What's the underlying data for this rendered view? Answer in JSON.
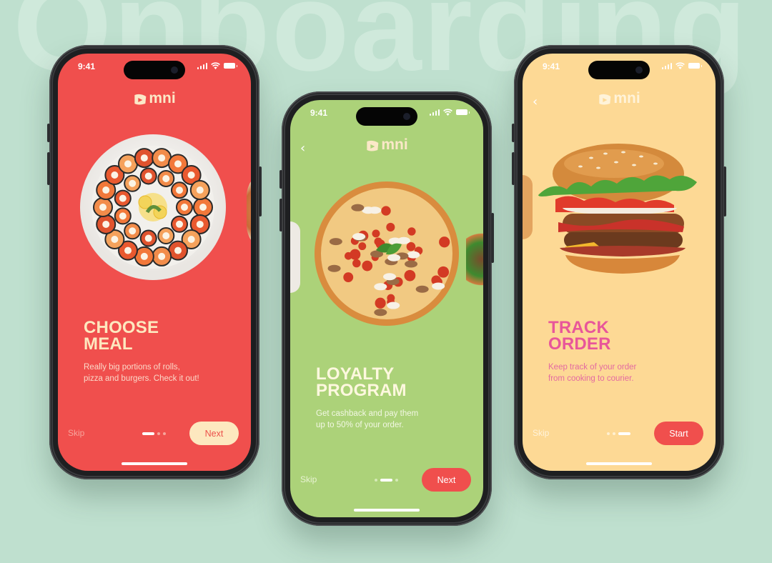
{
  "background_word": "Onboarding",
  "colors": {
    "red": "#f04f4d",
    "green": "#acd279",
    "yellow": "#fdd995",
    "pink": "#e8569a",
    "cream": "#fde8bf"
  },
  "screens": [
    {
      "id": "choose-meal",
      "time": "9:41",
      "logo": "mni",
      "title_line1": "CHOOSE",
      "title_line2": "MEAL",
      "subtitle_line1": "Really big portions of rolls,",
      "subtitle_line2": "pizza and burgers. Check it out!",
      "skip": "Skip",
      "cta": "Next",
      "dots_active": 0,
      "food": "sushi-platter"
    },
    {
      "id": "loyalty-program",
      "time": "9:41",
      "logo": "mni",
      "title_line1": "LOYALTY",
      "title_line2": "PROGRAM",
      "subtitle_line1": "Get cashback and pay them",
      "subtitle_line2": "up to 50% of your order.",
      "skip": "Skip",
      "cta": "Next",
      "dots_active": 1,
      "food": "pizza"
    },
    {
      "id": "track-order",
      "time": "9:41",
      "logo": "mni",
      "title_line1": "TRACK",
      "title_line2": "ORDER",
      "subtitle_line1": "Keep track of your order",
      "subtitle_line2": "from cooking to courier.",
      "skip": "Skip",
      "cta": "Start",
      "dots_active": 2,
      "food": "burger"
    }
  ]
}
